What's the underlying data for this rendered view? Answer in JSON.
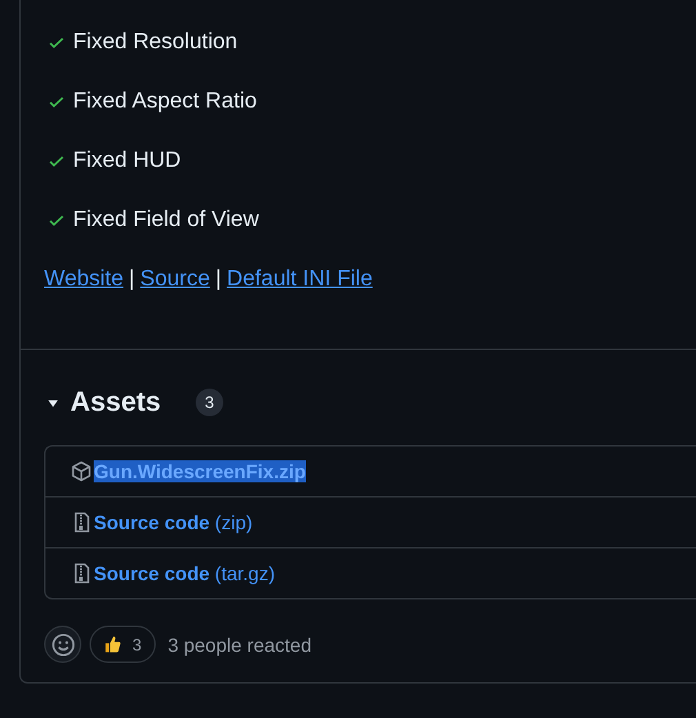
{
  "features": [
    {
      "text": "Fixed Resolution",
      "checked": true
    },
    {
      "text": "Fixed Aspect Ratio",
      "checked": true
    },
    {
      "text": "Fixed HUD",
      "checked": true
    },
    {
      "text": "Fixed Field of View",
      "checked": true
    }
  ],
  "links": [
    "Website",
    "Source",
    "Default INI File"
  ],
  "link_separator": "|",
  "assets": {
    "title": "Assets",
    "expanded": true,
    "count": "3",
    "items": [
      {
        "kind": "package",
        "name": "Gun.WidescreenFix.zip",
        "highlighted": true
      },
      {
        "kind": "archive",
        "name": "Source code",
        "suffix": "(zip)",
        "highlighted": false
      },
      {
        "kind": "archive",
        "name": "Source code",
        "suffix": "(tar.gz)",
        "highlighted": false
      }
    ]
  },
  "reactions": {
    "items": [
      {
        "kind": "thumbs-up",
        "count": "3"
      }
    ],
    "summary": "3 people reacted"
  }
}
